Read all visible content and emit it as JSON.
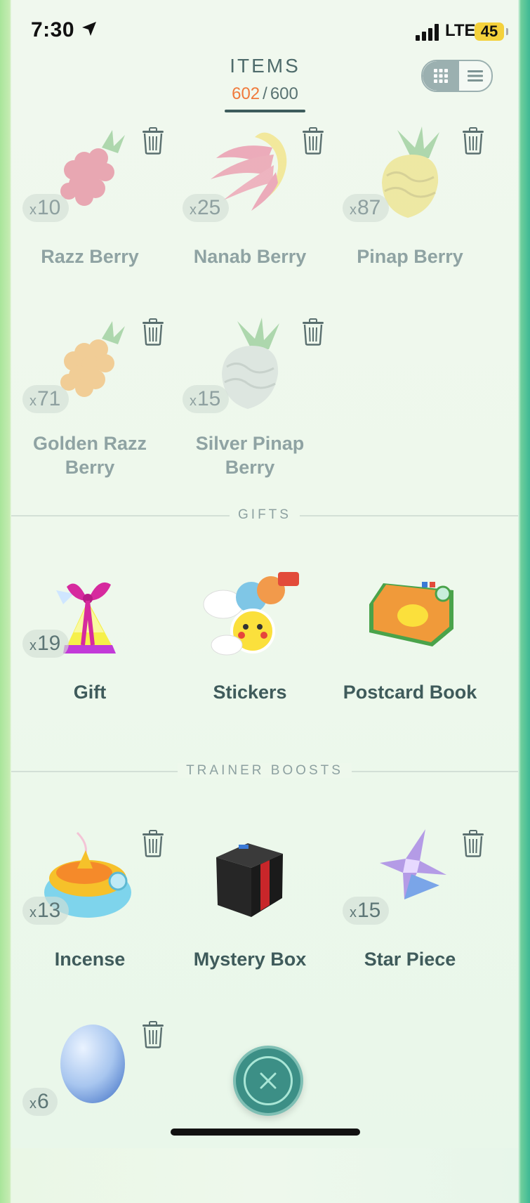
{
  "status_bar": {
    "time": "7:30",
    "network": "LTE",
    "battery": "45"
  },
  "header": {
    "title": "ITEMS",
    "count_current": "602",
    "count_separator": "/",
    "count_max": "600"
  },
  "berries": [
    {
      "name": "Razz Berry",
      "quantity": "10",
      "x_prefix": "x",
      "icon": "razz-berry-icon"
    },
    {
      "name": "Nanab Berry",
      "quantity": "25",
      "x_prefix": "x",
      "icon": "nanab-berry-icon"
    },
    {
      "name": "Pinap Berry",
      "quantity": "87",
      "x_prefix": "x",
      "icon": "pinap-berry-icon"
    },
    {
      "name": "Golden Razz Berry",
      "name_line1": "Golden Razz",
      "name_line2": "Berry",
      "quantity": "71",
      "x_prefix": "x",
      "icon": "golden-razz-berry-icon"
    },
    {
      "name": "Silver Pinap Berry",
      "name_line1": "Silver Pinap",
      "name_line2": "Berry",
      "quantity": "15",
      "x_prefix": "x",
      "icon": "silver-pinap-berry-icon"
    }
  ],
  "gifts_section": {
    "label": "GIFTS",
    "items": [
      {
        "name": "Gift",
        "quantity": "19",
        "x_prefix": "x",
        "icon": "gift-icon"
      },
      {
        "name": "Stickers",
        "icon": "stickers-icon"
      },
      {
        "name": "Postcard Book",
        "icon": "postcard-book-icon"
      }
    ]
  },
  "boosts_section": {
    "label": "TRAINER BOOSTS",
    "items": [
      {
        "name": "Incense",
        "quantity": "13",
        "x_prefix": "x",
        "icon": "incense-icon"
      },
      {
        "name": "Mystery Box",
        "icon": "mystery-box-icon"
      },
      {
        "name": "Star Piece",
        "quantity": "15",
        "x_prefix": "x",
        "icon": "star-piece-icon"
      },
      {
        "name": "Egg",
        "quantity": "6",
        "x_prefix": "x",
        "icon": "egg-icon"
      }
    ]
  },
  "colors": {
    "accent_count": "#f07a3c",
    "text": "#3f5b5b",
    "close_button": "#3c8f86"
  }
}
